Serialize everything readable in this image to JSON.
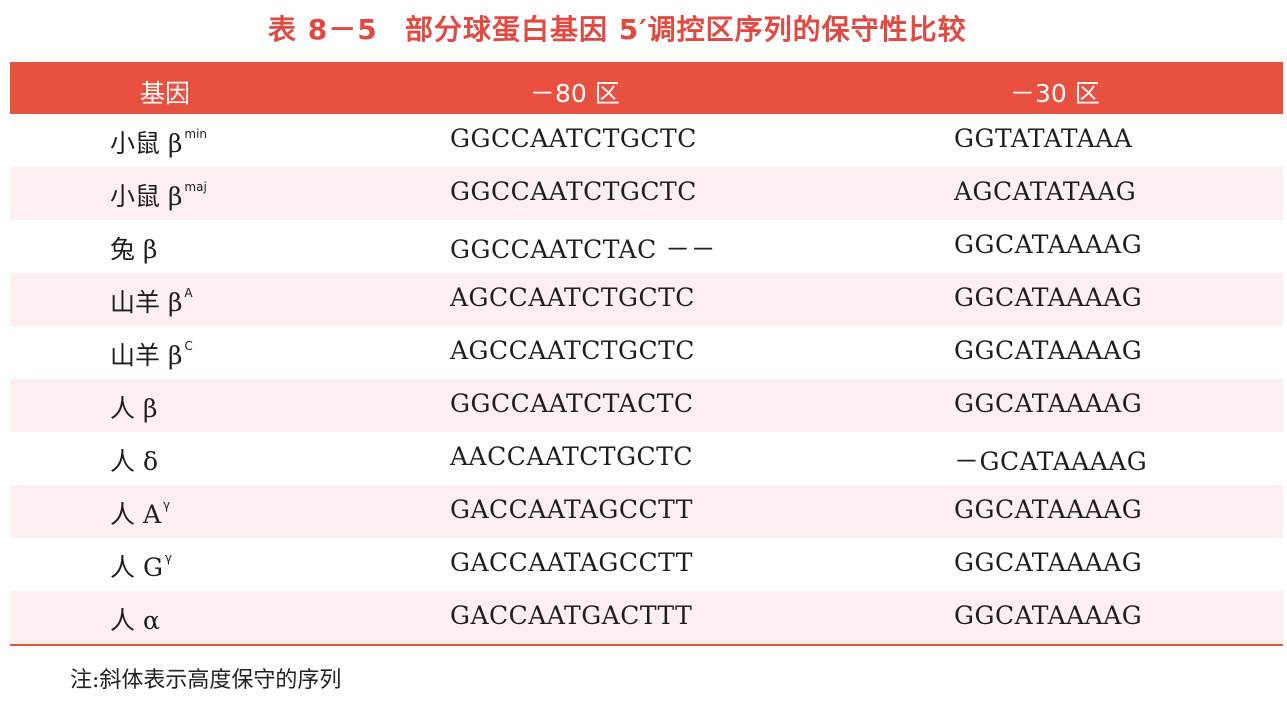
{
  "title": {
    "number": "表 8－5",
    "text": "部分球蛋白基因 5′调控区序列的保守性比较"
  },
  "table": {
    "headers": {
      "gene": "基因",
      "region80": "－80 区",
      "region30": "－30 区"
    },
    "rows": [
      {
        "gene": "小鼠 β",
        "sup": "min",
        "seq80": "GGCCAATCTGCTC",
        "seq30": "GGTATATAAA"
      },
      {
        "gene": "小鼠 β",
        "sup": "maj",
        "seq80": "GGCCAATCTGCTC",
        "seq30": "AGCATATAAG"
      },
      {
        "gene": "兔 β",
        "sup": "",
        "seq80": "GGCCAATCTAC －－",
        "seq30": "GGCATAAAAG"
      },
      {
        "gene": "山羊 β",
        "sup": "A",
        "seq80": "AGCCAATCTGCTC",
        "seq30": "GGCATAAAAG"
      },
      {
        "gene": "山羊 β",
        "sup": "C",
        "seq80": "AGCCAATCTGCTC",
        "seq30": "GGCATAAAAG"
      },
      {
        "gene": "人 β",
        "sup": "",
        "seq80": "GGCCAATCTACTC",
        "seq30": "GGCATAAAAG"
      },
      {
        "gene": "人 δ",
        "sup": "",
        "seq80": "AACCAATCTGCTC",
        "seq30": "－GCATAAAAG"
      },
      {
        "gene": "人 A",
        "sup": "γ",
        "seq80": "GACCAATAGCCTT",
        "seq30": "GGCATAAAAG"
      },
      {
        "gene": "人 G",
        "sup": "γ",
        "seq80": "GACCAATAGCCTT",
        "seq30": "GGCATAAAAG"
      },
      {
        "gene": "人 α",
        "sup": "",
        "seq80": "GACCAATGACTTT",
        "seq30": "GGCATAAAAG"
      }
    ]
  },
  "note": "注:斜体表示高度保守的序列",
  "colors": {
    "accent": "#e8503f",
    "title": "#e04a42",
    "row_shade": "#fbefef"
  }
}
